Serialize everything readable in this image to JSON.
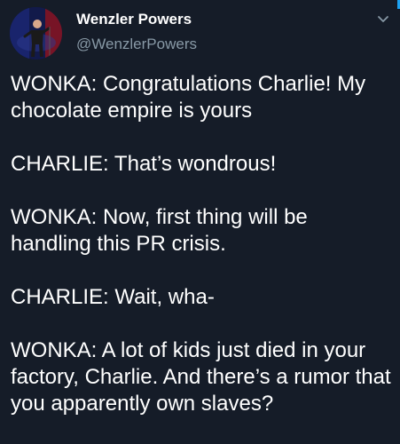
{
  "author": {
    "display_name": "Wenzler Powers",
    "handle": "@WenzlerPowers",
    "avatar_icon": "performer-on-stage-avatar"
  },
  "menu": {
    "icon": "chevron-down-icon"
  },
  "tweet": {
    "paragraphs": [
      "WONKA: Congratulations Charlie! My chocolate empire is yours",
      "CHARLIE: That’s wondrous!",
      "WONKA: Now, first thing will be handling this PR crisis.",
      "CHARLIE: Wait, wha-",
      "WONKA: A lot of kids just died in your factory, Charlie. And there’s a rumor that you apparently own slaves?"
    ]
  },
  "colors": {
    "background": "#151c28",
    "text": "#ffffff",
    "secondary_text": "#8899a6",
    "accent": "#1da1f2"
  }
}
